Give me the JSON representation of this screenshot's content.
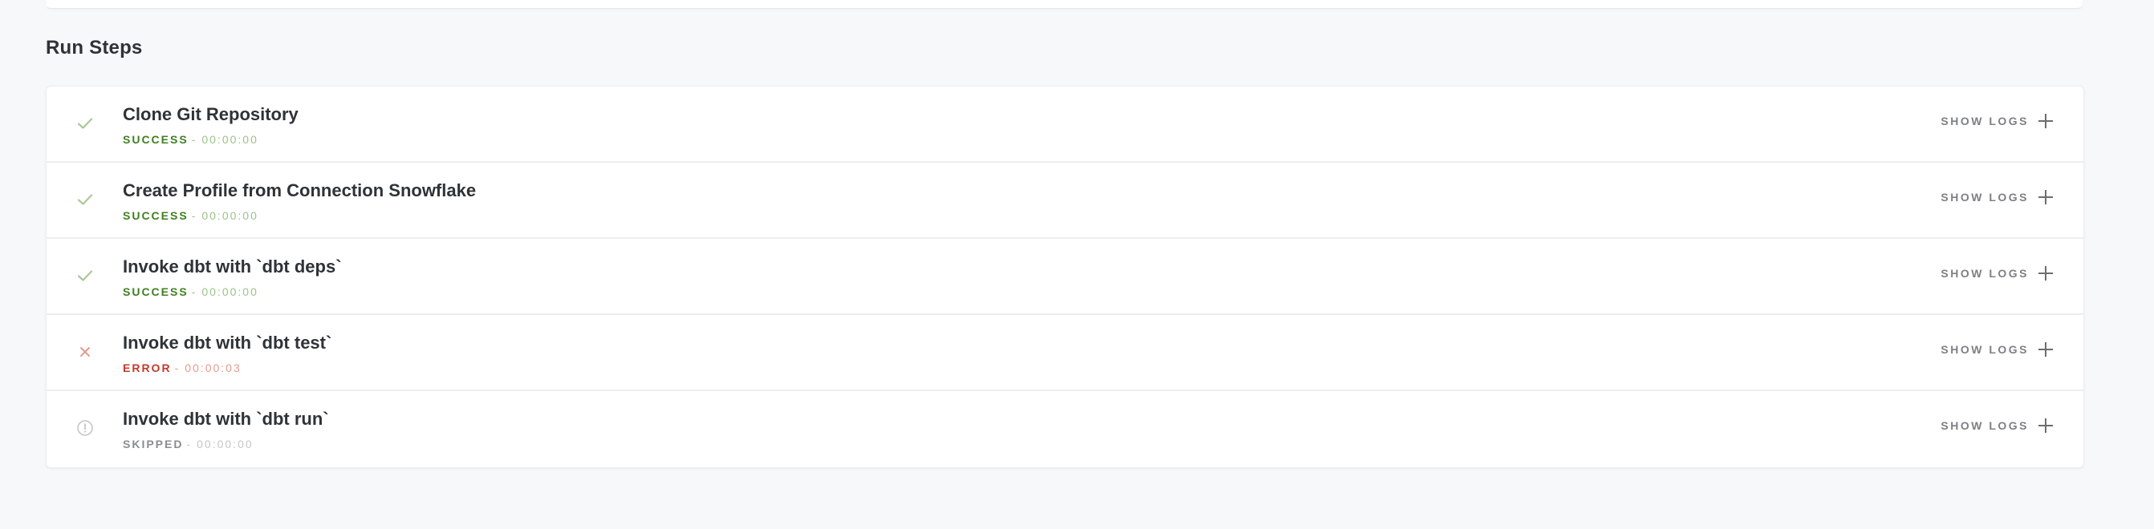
{
  "section": {
    "title": "Run Steps"
  },
  "steps": [
    {
      "title": "Clone Git Repository",
      "status": "SUCCESS",
      "separator": "-",
      "duration": "00:00:00",
      "icon": "check-icon",
      "action_label": "SHOW LOGS"
    },
    {
      "title": "Create Profile from Connection Snowflake",
      "status": "SUCCESS",
      "separator": "-",
      "duration": "00:00:00",
      "icon": "check-icon",
      "action_label": "SHOW LOGS"
    },
    {
      "title": "Invoke dbt with `dbt deps`",
      "status": "SUCCESS",
      "separator": "-",
      "duration": "00:00:00",
      "icon": "check-icon",
      "action_label": "SHOW LOGS"
    },
    {
      "title": "Invoke dbt with `dbt test`",
      "status": "ERROR",
      "separator": "-",
      "duration": "00:00:03",
      "icon": "x-icon",
      "action_label": "SHOW LOGS"
    },
    {
      "title": "Invoke dbt with `dbt run`",
      "status": "SKIPPED",
      "separator": "-",
      "duration": "00:00:00",
      "icon": "info-circle-icon",
      "action_label": "SHOW LOGS"
    }
  ],
  "colors": {
    "success": "#3f7f1f",
    "error": "#c23a2a",
    "skipped": "#8a8d91",
    "check": "#a9c998",
    "x": "#e79a8e",
    "info": "#c4c6c9"
  }
}
